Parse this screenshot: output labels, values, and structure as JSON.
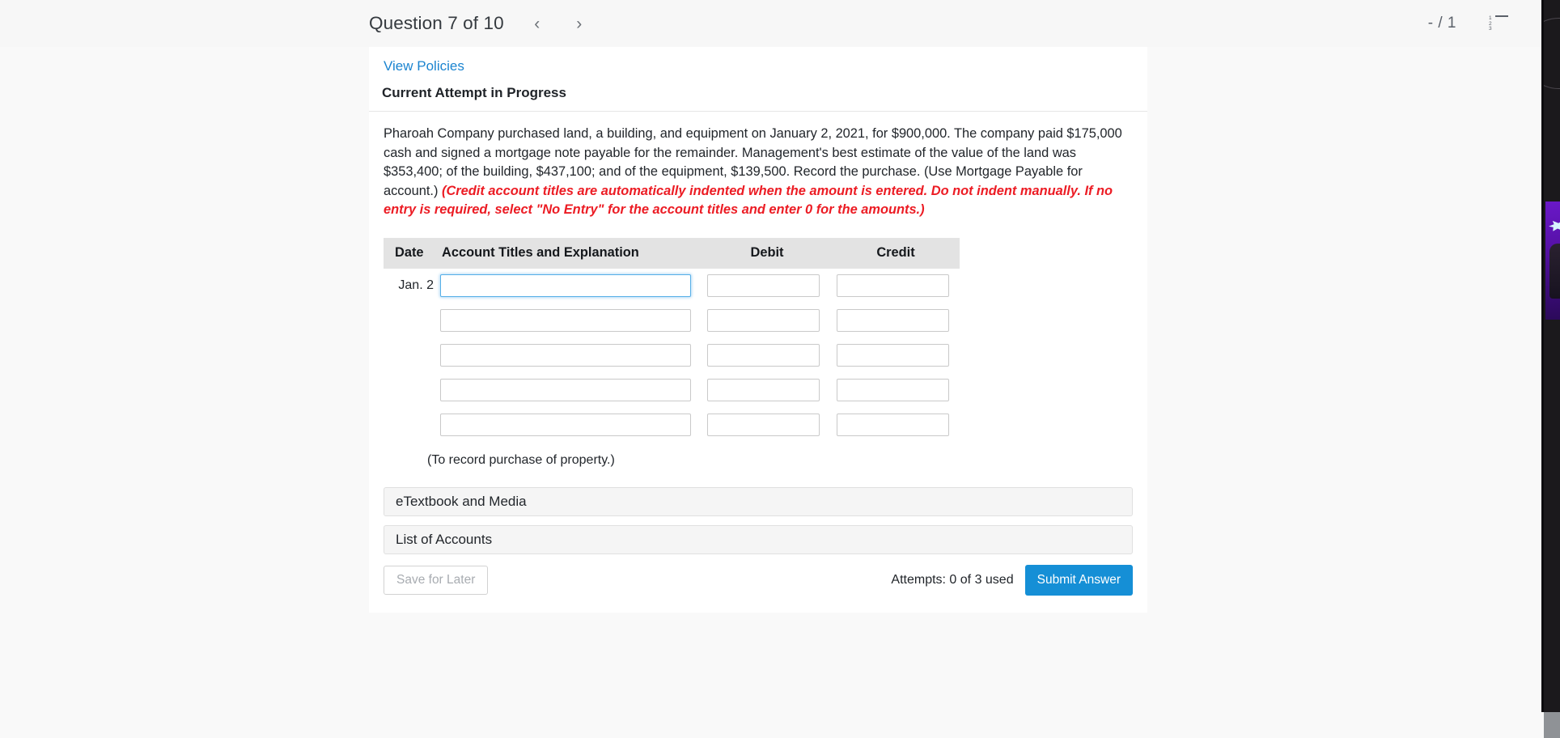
{
  "page": {
    "background": "#f9f9f9"
  },
  "question_bar": {
    "title": "Question 7 of 10",
    "prev_icon": "chevron-left-icon",
    "next_icon": "chevron-right-icon",
    "prev_glyph": "‹",
    "next_glyph": "›",
    "score": "- / 1",
    "list_icon": "ordered-list-icon",
    "list_numbers": [
      "1",
      "2",
      "3"
    ]
  },
  "card": {
    "view_policies": "View Policies",
    "attempt_status": "Current Attempt in Progress",
    "question_text": {
      "part1": "Pharoah Company purchased land, a building, and equipment on January 2, 2021, for $900,000. The company paid $175,000 cash and signed a mortgage note payable for the remainder. Management's best estimate of the value of the land was $353,400; of the building, $437,100; and of the equipment, $139,500. Record the purchase. (Use Mortgage Payable for account.) ",
      "part2_red_italic": "(Credit account titles are automatically indented when the amount is entered. Do not indent manually. If no entry is required, select \"No Entry\" for the account titles and enter 0 for the amounts.)"
    },
    "red_color": "#ec1c24"
  },
  "journal": {
    "columns": {
      "date": "Date",
      "account": "Account Titles and Explanation",
      "debit": "Debit",
      "credit": "Credit"
    },
    "header_bg": "#e3e3e3",
    "rows": [
      {
        "date": "Jan. 2",
        "account": "",
        "debit": "",
        "credit": "",
        "focused": true
      },
      {
        "date": "",
        "account": "",
        "debit": "",
        "credit": "",
        "focused": false
      },
      {
        "date": "",
        "account": "",
        "debit": "",
        "credit": "",
        "focused": false
      },
      {
        "date": "",
        "account": "",
        "debit": "",
        "credit": "",
        "focused": false
      },
      {
        "date": "",
        "account": "",
        "debit": "",
        "credit": "",
        "focused": false
      }
    ],
    "memo": "(To record purchase of property.)",
    "focus_border_color": "#56afe8"
  },
  "panels": [
    {
      "label": "eTextbook and Media"
    },
    {
      "label": "List of Accounts"
    }
  ],
  "footer": {
    "save_for_later": "Save for Later",
    "attempts": "Attempts: 0 of 3 used",
    "submit": "Submit Answer",
    "submit_color": "#158fd6"
  }
}
